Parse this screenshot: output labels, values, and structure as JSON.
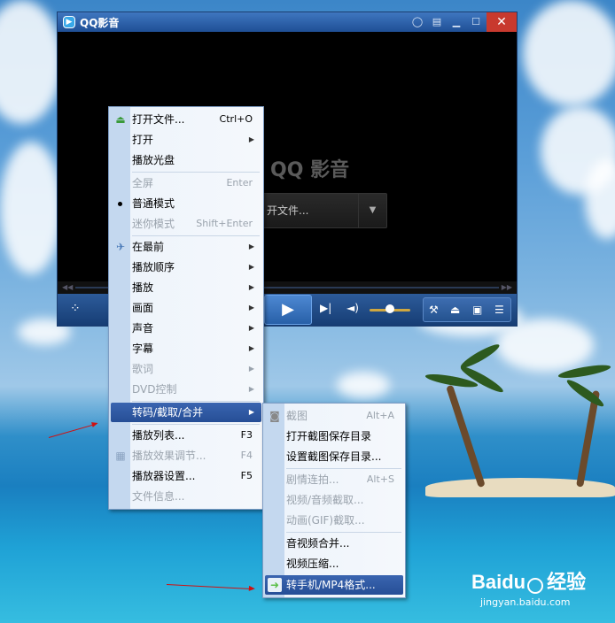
{
  "window": {
    "title": "QQ影音",
    "logo_text": "QQ 影音",
    "open_button_label": "开文件...",
    "controls": {
      "play": "▶",
      "next": "▶|",
      "volume": "🔊"
    }
  },
  "main_menu": {
    "items": [
      {
        "label": "打开文件...",
        "shortcut": "Ctrl+O",
        "icon": "eject-icon"
      },
      {
        "label": "打开",
        "submenu": true
      },
      {
        "label": "播放光盘"
      },
      {
        "label": "全屏",
        "shortcut": "Enter",
        "disabled": true
      },
      {
        "label": "普通模式",
        "checked": true
      },
      {
        "label": "迷你模式",
        "shortcut": "Shift+Enter",
        "disabled": true
      },
      {
        "label": "在最前",
        "submenu": true,
        "icon": "pin-icon"
      },
      {
        "label": "播放顺序",
        "submenu": true
      },
      {
        "label": "播放",
        "submenu": true
      },
      {
        "label": "画面",
        "submenu": true
      },
      {
        "label": "声音",
        "submenu": true
      },
      {
        "label": "字幕",
        "submenu": true
      },
      {
        "label": "歌词",
        "submenu": true,
        "disabled": true
      },
      {
        "label": "DVD控制",
        "submenu": true,
        "disabled": true
      },
      {
        "label": "转码/截取/合并",
        "submenu": true,
        "highlighted": true
      },
      {
        "label": "播放列表...",
        "shortcut": "F3"
      },
      {
        "label": "播放效果调节...",
        "shortcut": "F4",
        "disabled": true,
        "icon": "adjust-icon"
      },
      {
        "label": "播放器设置...",
        "shortcut": "F5"
      },
      {
        "label": "文件信息...",
        "disabled": true
      }
    ]
  },
  "sub_menu": {
    "items": [
      {
        "label": "截图",
        "shortcut": "Alt+A",
        "disabled": true,
        "icon": "camera-icon"
      },
      {
        "label": "打开截图保存目录"
      },
      {
        "label": "设置截图保存目录..."
      },
      {
        "label": "剧情连拍...",
        "shortcut": "Alt+S",
        "disabled": true
      },
      {
        "label": "视频/音频截取...",
        "disabled": true
      },
      {
        "label": "动画(GIF)截取...",
        "disabled": true
      },
      {
        "label": "音视频合并..."
      },
      {
        "label": "视频压缩..."
      },
      {
        "label": "转手机/MP4格式...",
        "highlighted": true,
        "icon": "convert-icon"
      }
    ]
  },
  "watermark": {
    "brand": "Baidu",
    "brand_suffix": "经验",
    "url": "jingyan.baidu.com"
  },
  "colors": {
    "highlight": "#2c56a0",
    "menu_bg": "#eef4fb",
    "annotation_arrow": "#d01010"
  }
}
